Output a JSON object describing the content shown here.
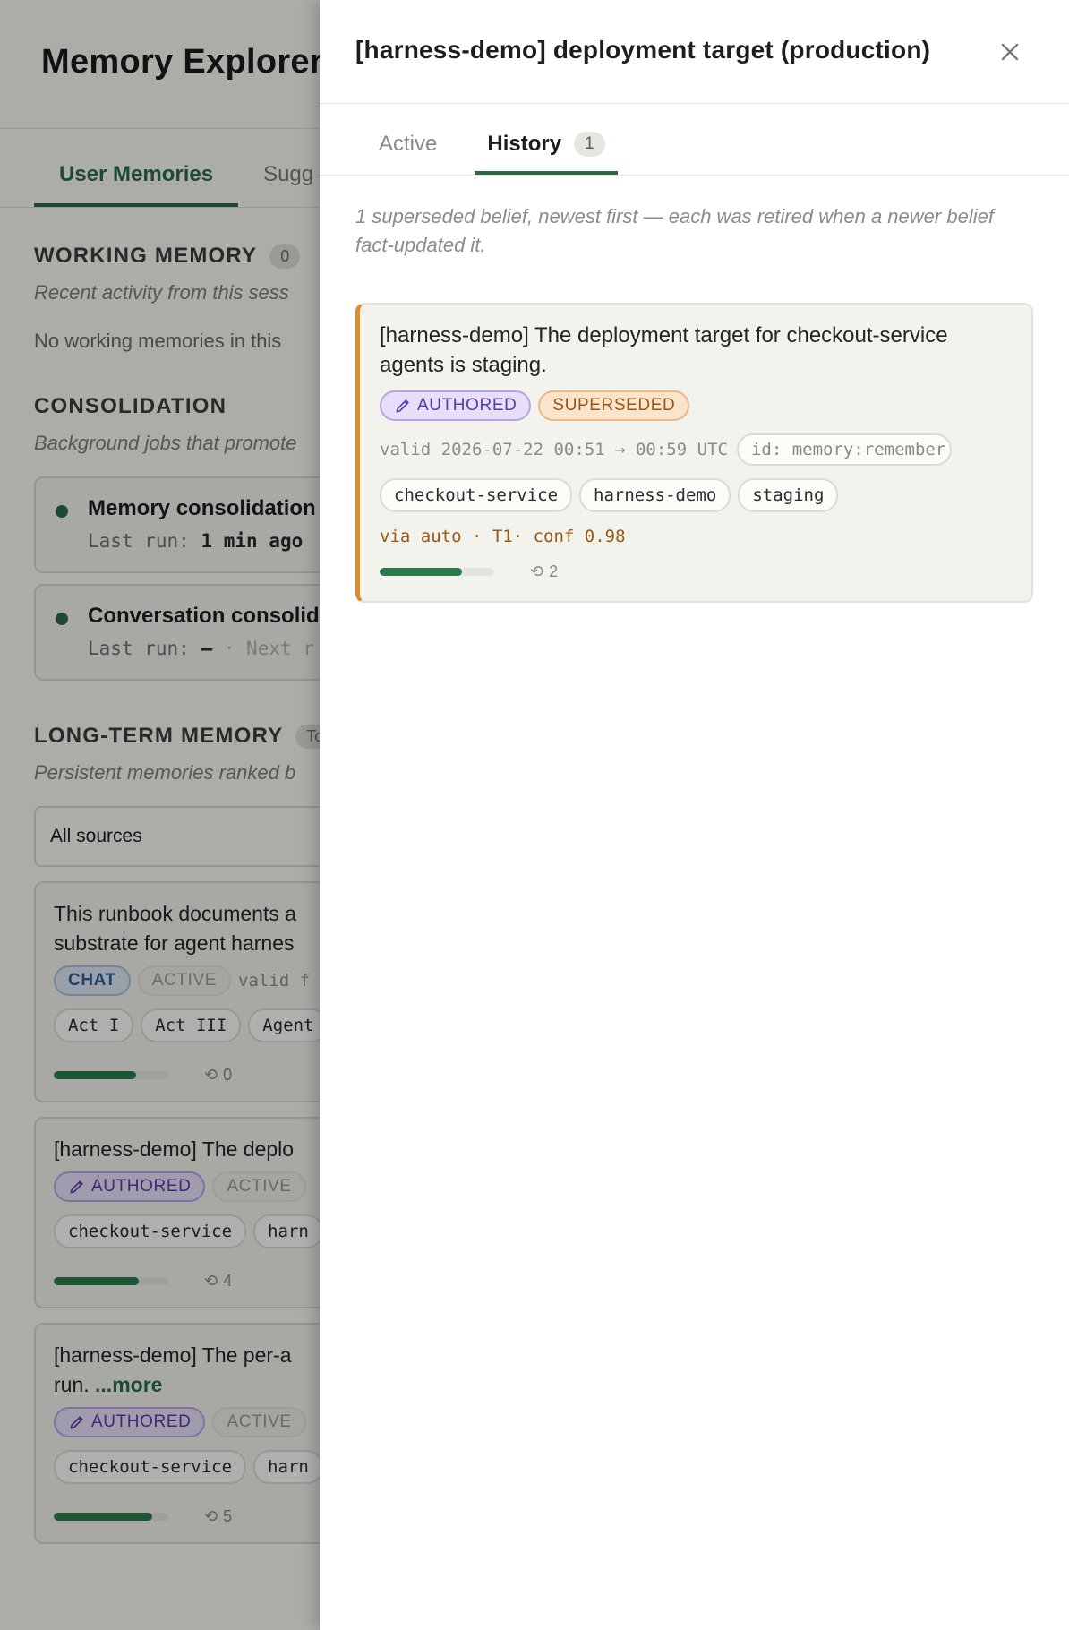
{
  "app": {
    "title": "Memory Explorer"
  },
  "main_tabs": [
    {
      "label": "User Memories",
      "active": true
    },
    {
      "label": "Sugg"
    }
  ],
  "working_memory": {
    "heading": "WORKING MEMORY",
    "count": "0",
    "subtitle": "Recent activity from this sess",
    "empty_text": "No working memories in this"
  },
  "consolidation": {
    "heading": "CONSOLIDATION",
    "subtitle": "Background jobs that promote",
    "jobs": [
      {
        "name": "Memory consolidation",
        "last_run_label": "Last run:",
        "last_run_value": "1 min ago",
        "status_color": "#2a6b45"
      },
      {
        "name": "Conversation consolid",
        "last_run_label": "Last run:",
        "last_run_value": "—",
        "next_label": "· Next r",
        "status_color": "#2a6b45"
      }
    ]
  },
  "long_term": {
    "heading": "LONG-TERM MEMORY",
    "count_label": "To",
    "subtitle": "Persistent memories ranked b",
    "source_filter": "All sources",
    "cards": [
      {
        "text_line1": "This runbook documents a",
        "text_line2": "substrate for agent harnes",
        "badges": [
          "CHAT",
          "ACTIVE"
        ],
        "valid": "valid f",
        "tags": [
          "Act I",
          "Act III",
          "Agent"
        ],
        "confidence": 0.72,
        "reuse": "0"
      },
      {
        "text_line1": "[harness-demo] The deplo",
        "badges": [
          "AUTHORED",
          "ACTIVE"
        ],
        "tags": [
          "checkout-service",
          "harn"
        ],
        "confidence": 0.74,
        "reuse": "4"
      },
      {
        "text_line1": "[harness-demo] The per-a",
        "text_line2": "run.",
        "more": "...more",
        "badges": [
          "AUTHORED",
          "ACTIVE"
        ],
        "tags": [
          "checkout-service",
          "harn"
        ],
        "confidence": 0.86,
        "reuse": "5"
      }
    ]
  },
  "drawer": {
    "title": "[harness-demo] deployment target (production)",
    "close_icon": "close-icon",
    "tabs": [
      {
        "label": "Active",
        "active": false
      },
      {
        "label": "History",
        "count": "1",
        "active": true
      }
    ],
    "note": "1 superseded belief, newest first — each was retired when a newer belief fact-updated it.",
    "history": [
      {
        "text": "[harness-demo] The deployment target for checkout-service agents is staging.",
        "badge_authored": "AUTHORED",
        "badge_status": "SUPERSEDED",
        "valid": "valid 2026-07-22 00:51 → 00:59 UTC",
        "id": "id: memory:remember",
        "tags": [
          "checkout-service",
          "harness-demo",
          "staging"
        ],
        "via": "via auto · T1· conf 0.98",
        "confidence": 0.72,
        "reuse": "2",
        "accent": "#e08a2b"
      }
    ]
  },
  "colors": {
    "brand": "#2a6b45",
    "authored": "#5b3aa7",
    "superseded": "#9a5512"
  }
}
